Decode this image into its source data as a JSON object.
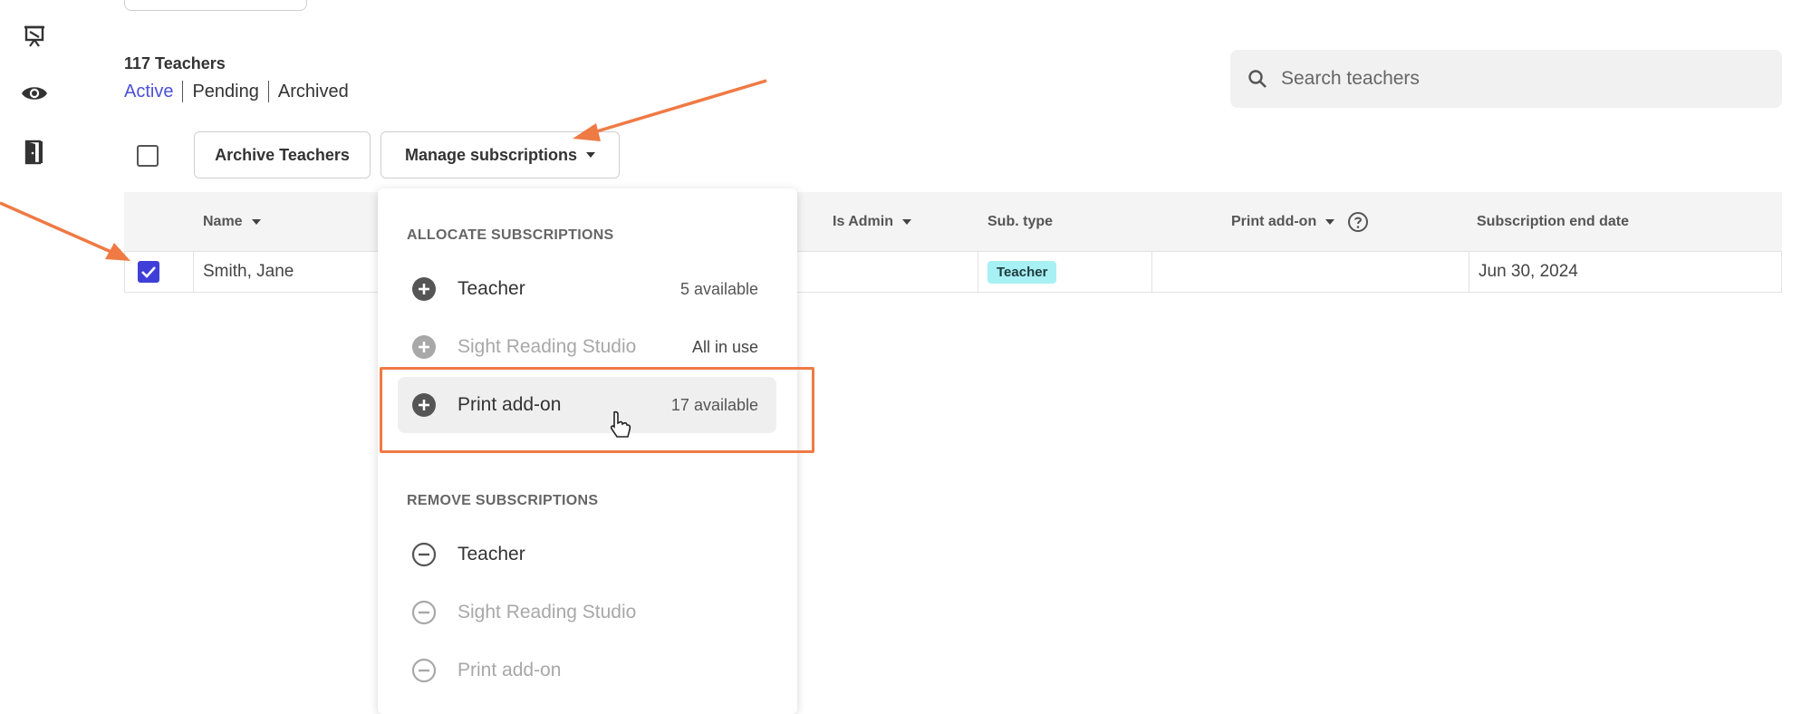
{
  "sidebar": {
    "icons": [
      "presentation-icon",
      "eye-icon",
      "exit-door-icon"
    ]
  },
  "header": {
    "count_title": "117 Teachers",
    "tabs": [
      {
        "label": "Active",
        "active": true
      },
      {
        "label": "Pending",
        "active": false
      },
      {
        "label": "Archived",
        "active": false
      }
    ],
    "search_placeholder": "Search teachers"
  },
  "toolbar": {
    "archive_label": "Archive Teachers",
    "manage_label": "Manage subscriptions"
  },
  "table": {
    "columns": [
      "Name",
      "Is Admin",
      "Sub. type",
      "Print add-on",
      "Subscription end date"
    ],
    "rows": [
      {
        "checked": true,
        "name": "Smith, Jane",
        "sub_type": "Teacher",
        "end_date": "Jun 30, 2024"
      }
    ]
  },
  "menu": {
    "allocate_heading": "ALLOCATE SUBSCRIPTIONS",
    "allocate_items": [
      {
        "label": "Teacher",
        "meta": "5 available",
        "disabled": false
      },
      {
        "label": "Sight Reading Studio",
        "meta": "All in use",
        "disabled": true
      },
      {
        "label": "Print add-on",
        "meta": "17 available",
        "disabled": false
      }
    ],
    "remove_heading": "REMOVE SUBSCRIPTIONS",
    "remove_items": [
      {
        "label": "Teacher",
        "disabled": false
      },
      {
        "label": "Sight Reading Studio",
        "disabled": true
      },
      {
        "label": "Print add-on",
        "disabled": true
      }
    ]
  },
  "colors": {
    "accent": "#4b50d8",
    "checkbox": "#3f3fd8",
    "annotation": "#ef7a44",
    "badge": "#a7f0f4"
  }
}
